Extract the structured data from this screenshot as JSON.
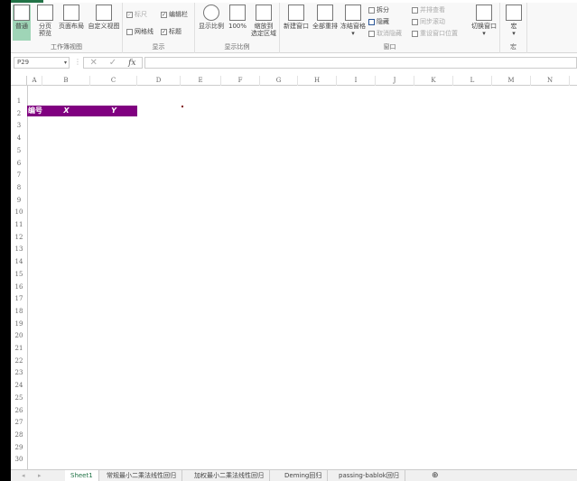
{
  "ribbon": {
    "workbook_views": {
      "label": "工作簿视图",
      "normal": "普通",
      "page_break": "分页\n预览",
      "page_layout": "页面布局",
      "custom": "自定义视图"
    },
    "show": {
      "label": "显示",
      "ruler": "标尺",
      "formula_bar": "编辑栏",
      "gridlines": "网格线",
      "headings": "标题",
      "ruler_checked": true,
      "formula_bar_checked": true,
      "gridlines_checked": false,
      "headings_checked": true
    },
    "zoom": {
      "label": "显示比例",
      "zoom": "显示比例",
      "zoom100": "100%",
      "zoom_selection": "缩放到\n选定区域"
    },
    "window": {
      "label": "窗口",
      "new_window": "新建窗口",
      "arrange_all": "全部重排",
      "freeze": "冻结窗格",
      "split": "拆分",
      "hide": "隐藏",
      "unhide": "取消隐藏",
      "side_by_side": "并排查看",
      "sync_scroll": "同步滚动",
      "reset_pos": "重设窗口位置",
      "switch": "切换窗口"
    },
    "macros": {
      "label": "宏",
      "macros": "宏"
    }
  },
  "formula_bar": {
    "name_box": "P29",
    "fx": "fx",
    "value": ""
  },
  "columns": [
    "A",
    "B",
    "C",
    "D",
    "E",
    "F",
    "G",
    "H",
    "I",
    "J",
    "K",
    "L",
    "M",
    "N"
  ],
  "rows": [
    "1",
    "2",
    "3",
    "4",
    "5",
    "6",
    "7",
    "8",
    "9",
    "10",
    "11",
    "12",
    "13",
    "14",
    "15",
    "16",
    "17",
    "18",
    "19",
    "20",
    "21",
    "22",
    "23",
    "24",
    "25",
    "26",
    "27",
    "28",
    "29",
    "30"
  ],
  "cells": {
    "A2": "编号",
    "B2": "X",
    "C2": "Y"
  },
  "header_fill": "#800080",
  "sheets": [
    "Sheet1",
    "常规最小二乘法线性回归",
    "加权最小二乘法线性回归",
    "Deming回归",
    "passing-bablok回归"
  ],
  "active_sheet": "Sheet1"
}
